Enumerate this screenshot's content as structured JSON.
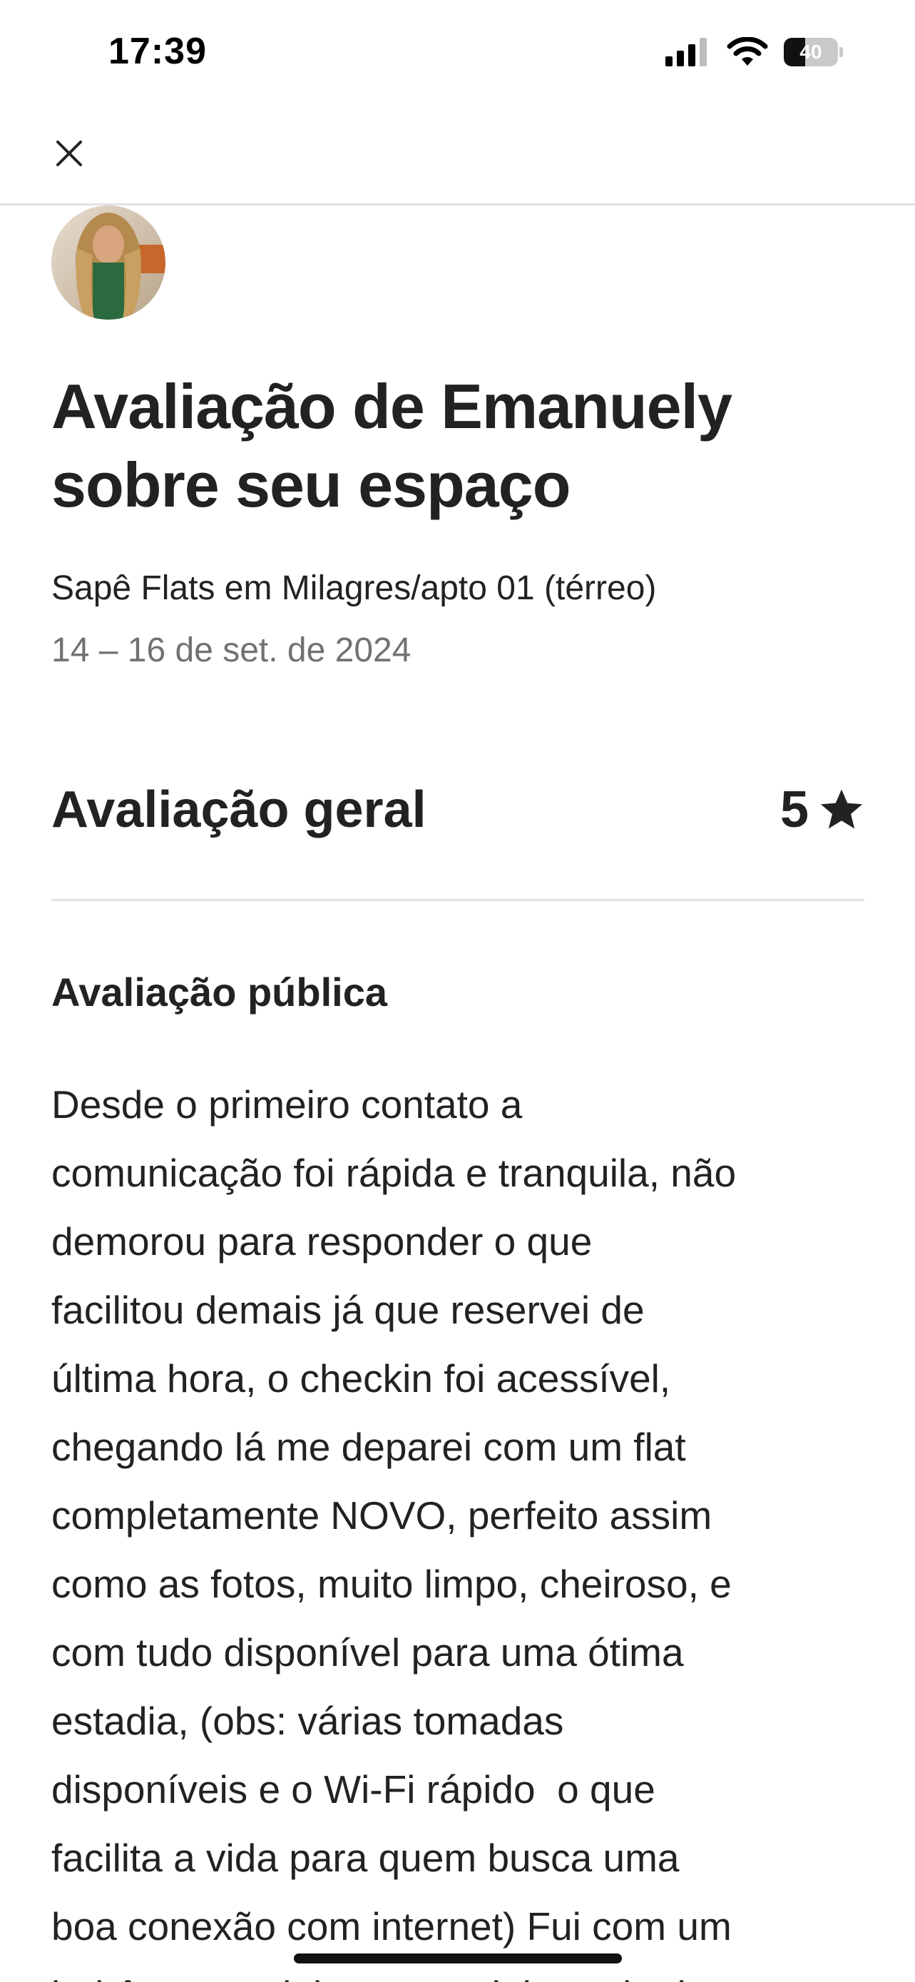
{
  "status_bar": {
    "time": "17:39",
    "battery_level": "40",
    "battery_fraction": 0.4,
    "icons": [
      "signal-icon",
      "wifi-icon",
      "battery-icon"
    ]
  },
  "nav": {
    "close_icon": "close-icon"
  },
  "review": {
    "title": "Avaliação de Emanuely sobre seu espaço",
    "listing_name": "Sapê Flats em Milagres/apto 01 (térreo)",
    "dates": "14 – 16 de set. de 2024",
    "overall_label": "Avaliação geral",
    "overall_value": "5",
    "public_heading": "Avaliação pública",
    "public_text_lines": [
      "Desde o primeiro contato a",
      "comunicação foi rápida e tranquila, não",
      "demorou para responder o que",
      "facilitou demais já que reservei de",
      "última hora, o checkin foi acessível,",
      "chegando lá me deparei com um flat",
      "completamente NOVO, perfeito assim",
      "como as fotos, muito limpo, cheiroso, e",
      "com tudo disponível para uma ótima",
      "estadia, (obs: várias tomadas",
      "disponíveis e o Wi-Fi rápido  o que",
      "facilita a vida para quem busca uma",
      "boa conexão com internet) Fui com um",
      "bebê e um adolescente, tinha tudo de"
    ]
  },
  "colors": {
    "text_primary": "#222222",
    "text_secondary": "#717171",
    "divider": "#e2e2e2"
  }
}
